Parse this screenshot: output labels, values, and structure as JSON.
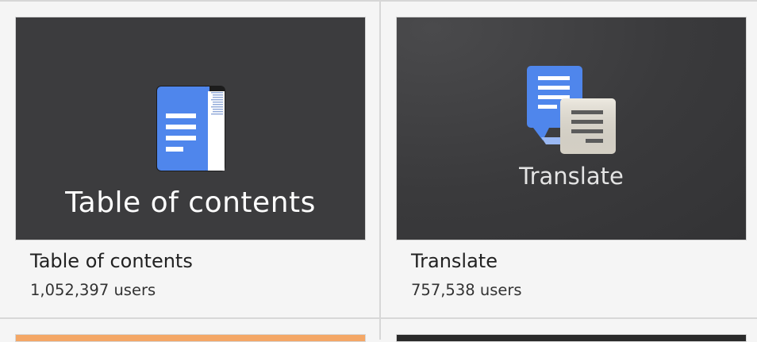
{
  "addons": [
    {
      "thumbnail_caption": "Table of contents",
      "title": "Table of contents",
      "users": "1,052,397 users",
      "icon": "table-of-contents-icon"
    },
    {
      "thumbnail_caption": "Translate",
      "title": "Translate",
      "users": "757,538 users",
      "icon": "translate-icon"
    }
  ],
  "colors": {
    "docs_blue": "#4f86ec",
    "thumbnail_dark": "#3c3c3e",
    "next_card_orange": "#f4a766"
  }
}
